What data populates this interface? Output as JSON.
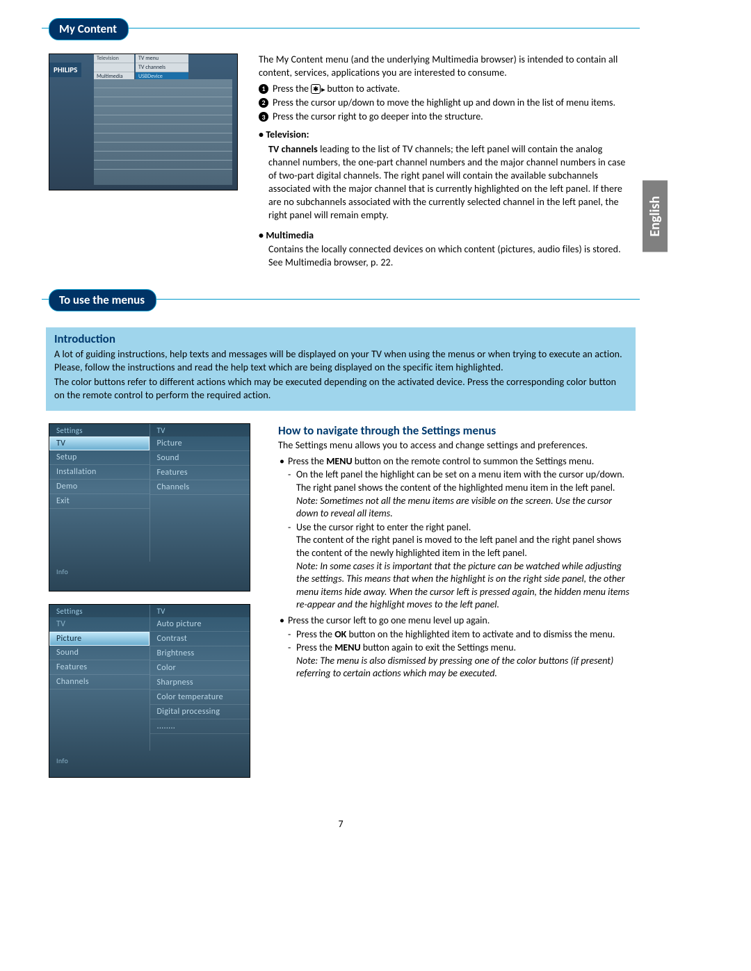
{
  "language_tab": "English",
  "page_number": "7",
  "sections": {
    "mycontent": {
      "title": "My Content",
      "intro": "The My Content menu (and the underlying Multimedia browser) is intended to contain all content, services, applications you are interested to consume.",
      "steps": [
        "Press the",
        "button to activate.",
        "Press the cursor up/down to move the highlight up and down in the list of menu items.",
        "Press the cursor right to go deeper into the structure."
      ],
      "tv_heading": "• Television:",
      "tv_body": "TV channels leading to the list of TV channels; the left panel will contain the analog channel numbers, the one-part channel numbers and the major channel numbers in case of two-part digital channels. The right panel will contain the available subchannels associated with the major channel that is currently highlighted on the left panel. If there are no subchannels associated with the currently selected channel in the left panel, the right panel will remain empty.",
      "tv_bold_lead": "TV channels",
      "mm_heading": "• Multimedia",
      "mm_body": "Contains the locally connected devices on which content (pictures, audio files) is stored. See Multimedia browser, p. 22."
    },
    "menus": {
      "title": "To use the menus",
      "intro_heading": "Introduction",
      "intro_p1": "A lot of guiding instructions, help texts and messages will be displayed on your TV when using the menus or when trying to execute an action. Please, follow the instructions and read the help text which are being displayed on the specific item highlighted.",
      "intro_p2": "The color buttons refer to different actions which may be executed depending on the activated device. Press the corresponding color button on the remote control to perform the required action.",
      "howto_heading": "How to navigate through the Settings menus",
      "howto_lead": "The Settings menu allows you to access and change settings and preferences.",
      "b1": "Press the MENU button on the remote control to summon the Settings menu.",
      "b1_word": "MENU",
      "b1_d1": "On the left panel the highlight can be set on a menu item with the cursor up/down.",
      "b1_d1b": "The right panel shows the content of the highlighted menu item in the left panel.",
      "b1_note": "Note: Sometimes not all the menu items are visible on the screen. Use the cursor down to reveal all items.",
      "b1_d2": "Use the cursor right to enter the right panel.",
      "b1_d2b": "The content of the right panel is moved to the left panel and the right panel shows the content of the newly highlighted item in the left panel.",
      "b1_note2": "Note: In some cases it is important that the picture can be watched while adjusting the settings. This means that when the highlight is on the right side panel, the other menu items hide away.  When the cursor left is pressed again, the hidden menu items re-appear and the highlight moves to the left panel.",
      "b2": "Press the cursor left to go one menu level up again.",
      "b2_d1a": "Press the ",
      "b2_d1_word": "OK",
      "b2_d1b": " button on the highlighted item to activate and to dismiss the menu.",
      "b2_d2a": "Press the ",
      "b2_d2_word": "MENU",
      "b2_d2b": " button again to exit the Settings menu.",
      "b2_note": "Note: The menu is also dismissed by pressing one of the color buttons (if present) referring to certain actions which may be executed."
    }
  },
  "shot1": {
    "brand": "PHILIPS",
    "col1": [
      "Television",
      "",
      "Multimedia"
    ],
    "col2": [
      "TV menu",
      "TV channels",
      "USBDevice",
      "............"
    ]
  },
  "shot2": {
    "head_left": "Settings",
    "head_right": "TV",
    "left": [
      "TV",
      "Setup",
      "Installation",
      "Demo",
      "Exit"
    ],
    "left_sel": "TV",
    "right": [
      "Picture",
      "Sound",
      "Features",
      "Channels"
    ],
    "foot": "Info"
  },
  "shot3": {
    "head_left": "Settings",
    "head_right": "TV",
    "left": [
      "TV",
      "Picture",
      "Sound",
      "Features",
      "Channels"
    ],
    "left_sel": "Picture",
    "right_head": "TV",
    "right": [
      "Auto picture",
      "Contrast",
      "Brightness",
      "Color",
      "Sharpness",
      "Color temperature",
      "Digital processing",
      "........"
    ],
    "foot": "Info"
  }
}
